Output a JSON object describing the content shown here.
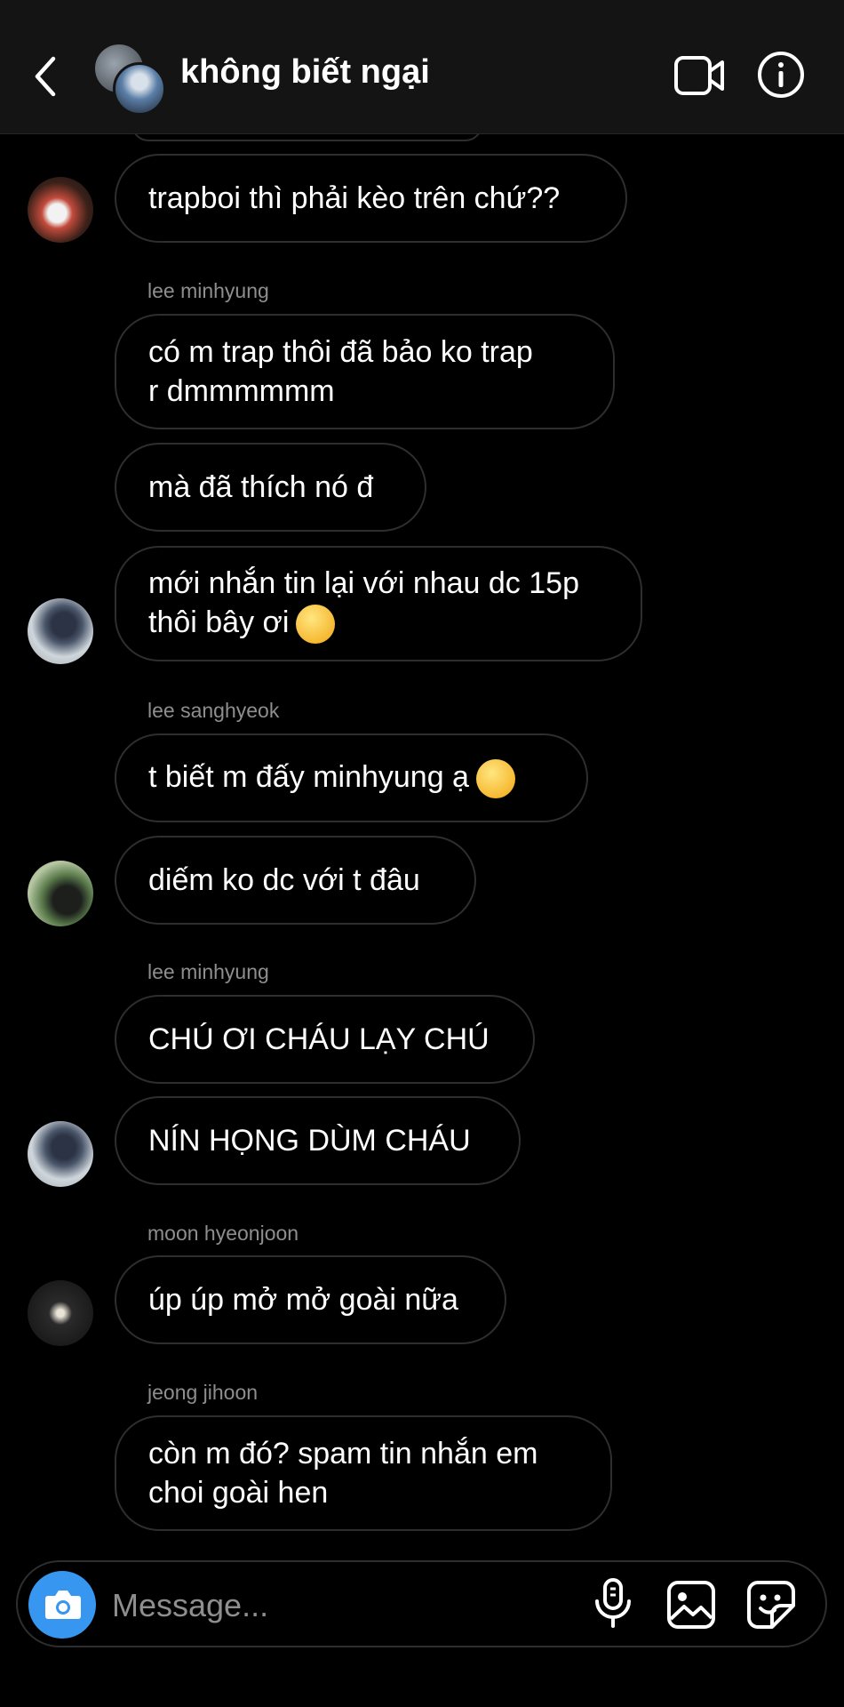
{
  "header": {
    "title": "không biết ngại",
    "back_icon": "chevron-left-icon",
    "video_icon": "video-camera-icon",
    "info_icon": "info-icon"
  },
  "messages": {
    "m1": "trapboi thì phải kèo trên chứ??",
    "sender_minhyung_1": "lee minhyung",
    "m2": "có m trap thôi đã bảo ko trap\nr dmmmmmm",
    "m3": "mà đã thích nó đ",
    "m4": "mới nhắn tin lại với nhau dc 15p\nthôi bây ơi",
    "sender_sanghyeok": "lee sanghyeok",
    "m5": "t biết m đấy minhyung ạ",
    "m6": "diếm ko dc với t đâu",
    "sender_minhyung_2": "lee minhyung",
    "m7": "CHÚ ƠI CHÁU LẠY CHÚ",
    "m8": "NÍN HỌNG DÙM CHÁU",
    "sender_hyeonjoon": "moon hyeonjoon",
    "m9": "úp úp mở mở goài nữa",
    "sender_jihoon": "jeong jihoon",
    "m10": "còn m đó? spam tin nhắn em\nchoi goài hen"
  },
  "composer": {
    "placeholder": "Message...",
    "camera_icon": "camera-icon",
    "mic_icon": "microphone-icon",
    "gallery_icon": "image-icon",
    "sticker_icon": "sticker-icon"
  },
  "colors": {
    "background": "#000000",
    "header_bg": "#141414",
    "bubble_border": "#2e2e2e",
    "camera_button": "#3797f0",
    "secondary_text": "#8e8e8e"
  }
}
